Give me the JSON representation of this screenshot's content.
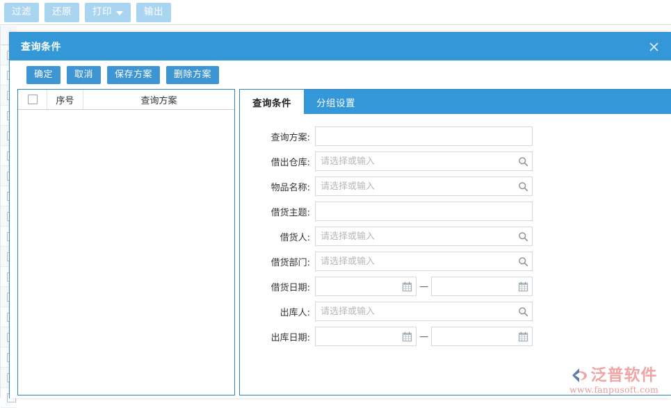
{
  "toolbar": {
    "buttons": [
      {
        "label": "过滤",
        "name": "filter-button",
        "dropdown": false
      },
      {
        "label": "还原",
        "name": "reset-button",
        "dropdown": false
      },
      {
        "label": "打印",
        "name": "print-button",
        "dropdown": true
      },
      {
        "label": "输出",
        "name": "export-button",
        "dropdown": false
      }
    ]
  },
  "dialog": {
    "title": "查询条件",
    "close_icon": "close-icon",
    "actions": [
      {
        "label": "确定",
        "name": "confirm-button"
      },
      {
        "label": "取消",
        "name": "cancel-button"
      },
      {
        "label": "保存方案",
        "name": "save-scheme-button"
      },
      {
        "label": "删除方案",
        "name": "delete-scheme-button"
      }
    ]
  },
  "scheme_table": {
    "columns": [
      "",
      "序号",
      "查询方案"
    ],
    "select_all_icon": "checkbox-icon",
    "rows": []
  },
  "tabs": [
    {
      "label": "查询条件",
      "name": "tab-query-conditions",
      "active": true
    },
    {
      "label": "分组设置",
      "name": "tab-group-settings",
      "active": false
    }
  ],
  "form": {
    "placeholder_select": "请选择或输入",
    "search_icon": "search-icon",
    "calendar_icon": "calendar-icon",
    "range_dash": "—",
    "fields": [
      {
        "label": "查询方案:",
        "name": "query-scheme-field",
        "type": "text",
        "value": "",
        "placeholder": ""
      },
      {
        "label": "借出仓库:",
        "name": "lending-warehouse-field",
        "type": "search",
        "value": "",
        "placeholder": "请选择或输入"
      },
      {
        "label": "物品名称:",
        "name": "item-name-field",
        "type": "search",
        "value": "",
        "placeholder": "请选择或输入"
      },
      {
        "label": "借货主题:",
        "name": "borrow-subject-field",
        "type": "text",
        "value": "",
        "placeholder": ""
      },
      {
        "label": "借货人:",
        "name": "borrower-field",
        "type": "search",
        "value": "",
        "placeholder": "请选择或输入"
      },
      {
        "label": "借货部门:",
        "name": "borrow-department-field",
        "type": "search",
        "value": "",
        "placeholder": "请选择或输入"
      },
      {
        "label": "借货日期:",
        "name": "borrow-date-field",
        "type": "daterange",
        "value_start": "",
        "value_end": ""
      },
      {
        "label": "出库人:",
        "name": "outbound-person-field",
        "type": "search",
        "value": "",
        "placeholder": "请选择或输入"
      },
      {
        "label": "出库日期:",
        "name": "outbound-date-field",
        "type": "daterange",
        "value_start": "",
        "value_end": ""
      }
    ]
  },
  "watermark": {
    "brand": "泛普软件",
    "url": "www.fanpusoft.com"
  },
  "colors": {
    "header_blue": "#3498d8",
    "button_blue": "#3d95d3",
    "toolbar_button_blue": "#a9d5f1",
    "panel_border": "#2f82bd",
    "watermark_pink": "#f0a5a5"
  }
}
